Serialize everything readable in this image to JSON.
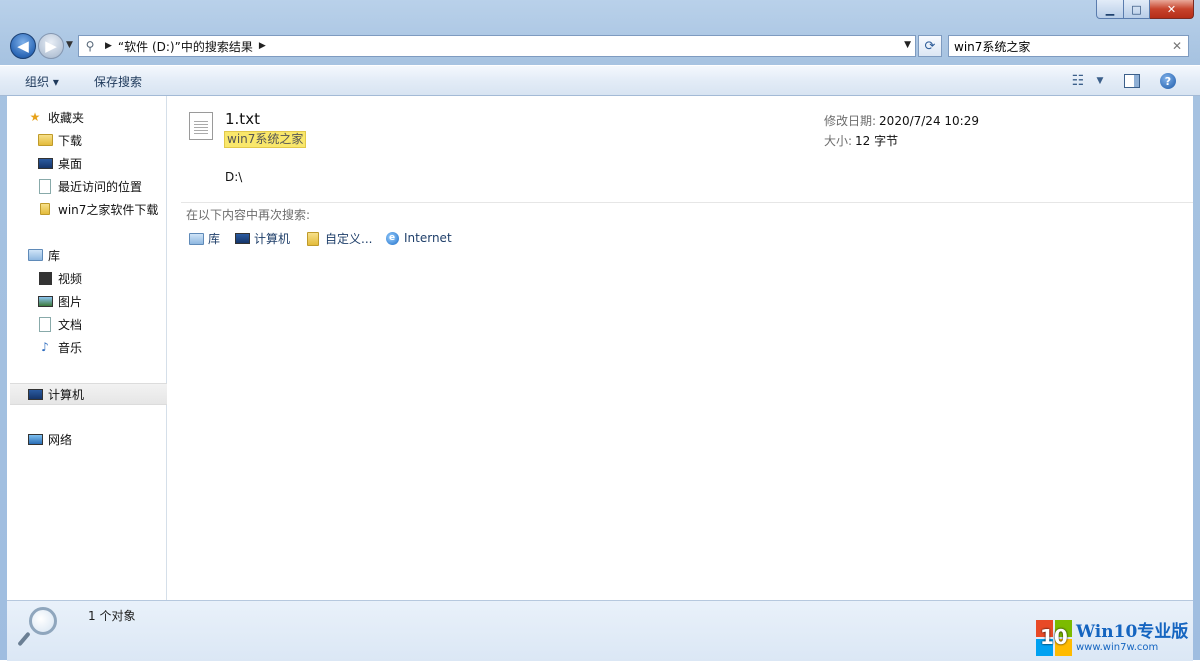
{
  "window": {
    "caption_buttons": [
      "minimize",
      "maximize",
      "close"
    ]
  },
  "nav": {
    "address_path": "“软件 (D:)”中的搜索结果",
    "search_value": "win7系统之家"
  },
  "commandbar": {
    "organize_label": "组织 ▾",
    "save_search_label": "保存搜索"
  },
  "navpane": {
    "favorites": "收藏夹",
    "downloads": "下载",
    "desktop": "桌面",
    "recent_places": "最近访问的位置",
    "win7_downloads": "win7之家软件下载",
    "libraries": "库",
    "videos": "视频",
    "pictures": "图片",
    "documents": "文档",
    "music": "音乐",
    "computer": "计算机",
    "network": "网络"
  },
  "result": {
    "file_name": "1.txt",
    "match_text": "win7系统之家",
    "path": "D:\\",
    "date_label": "修改日期:",
    "date_value": "2020/7/24 10:29",
    "size_label": "大小:",
    "size_value": "12 字节"
  },
  "search_again": {
    "label": "在以下内容中再次搜索:",
    "locations": [
      "库",
      "计算机",
      "自定义...",
      "Internet"
    ]
  },
  "status": {
    "item_count": "1 个对象"
  },
  "watermark": {
    "logo_number": "10",
    "title": "Win10专业版",
    "url": "www.win7w.com"
  }
}
